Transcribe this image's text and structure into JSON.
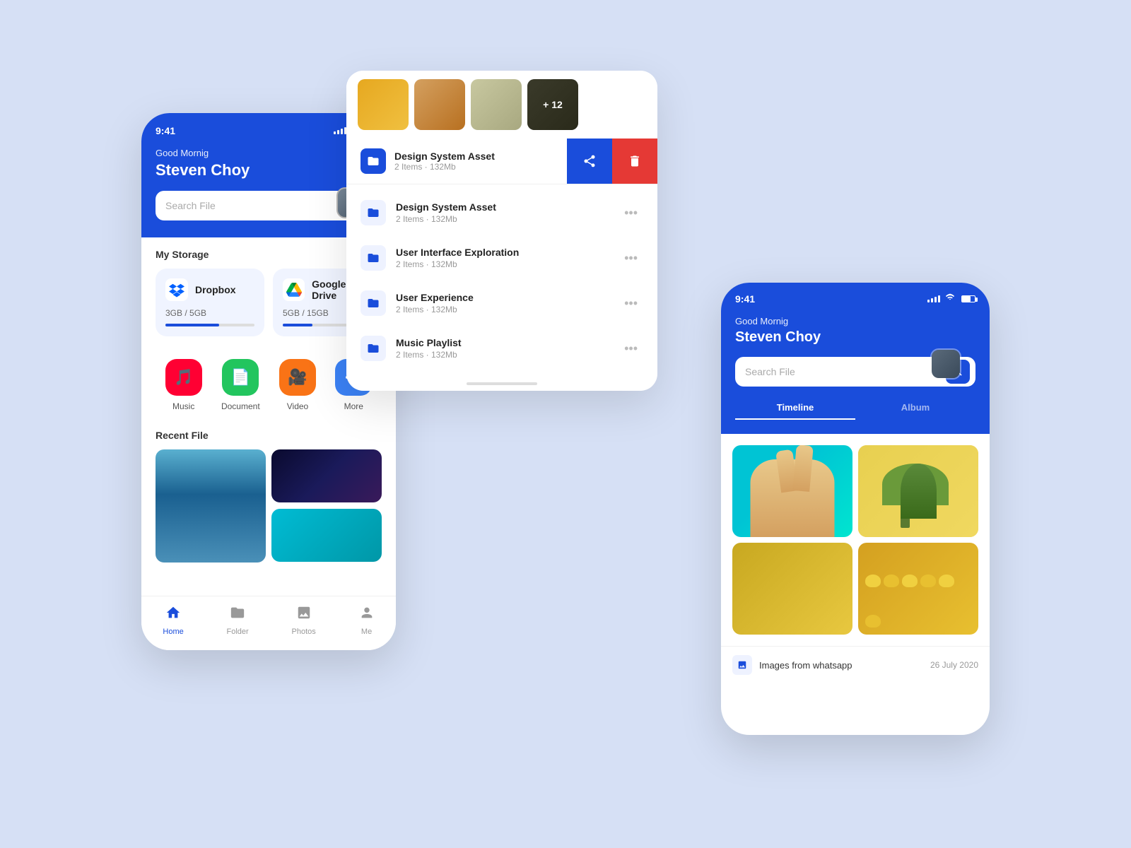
{
  "colors": {
    "blue": "#1a4ddb",
    "red": "#e53935",
    "white": "#ffffff",
    "background": "#d6e0f5"
  },
  "phone1": {
    "status": {
      "time": "9:41"
    },
    "header": {
      "greeting": "Good Mornig",
      "name": "Steven Choy",
      "search_placeholder": "Search File"
    },
    "storage": {
      "title": "My Storage",
      "dropbox": {
        "name": "Dropbox",
        "used": "3GB / 5GB",
        "progress": 60
      },
      "googledrive": {
        "name": "Google Drive",
        "used": "5GB / 15GB",
        "progress": 33
      }
    },
    "actions": {
      "music": "Music",
      "document": "Document",
      "video": "Video",
      "more": "More"
    },
    "recent": {
      "title": "Recent File"
    },
    "nav": {
      "home": "Home",
      "folder": "Folder",
      "photos": "Photos",
      "me": "Me"
    }
  },
  "folder_panel": {
    "context_item": {
      "name": "Design System Asset",
      "meta": "2 Items · 132Mb"
    },
    "image_strip": {
      "plus_count": "+ 12"
    },
    "items": [
      {
        "name": "Design System Asset",
        "meta": "2 Items · 132Mb"
      },
      {
        "name": "User Interface Exploration",
        "meta": "2 Items · 132Mb"
      },
      {
        "name": "User Experience",
        "meta": "2 Items · 132Mb"
      },
      {
        "name": "Music Playlist",
        "meta": "2 Items · 132Mb"
      }
    ]
  },
  "phone2": {
    "status": {
      "time": "9:41"
    },
    "header": {
      "greeting": "Good Mornig",
      "name": "Steven Choy",
      "search_placeholder": "Search File"
    },
    "tabs": {
      "timeline": "Timeline",
      "album": "Album"
    },
    "album_footer": {
      "title": "Images from whatsapp",
      "date": "26 July 2020"
    }
  }
}
